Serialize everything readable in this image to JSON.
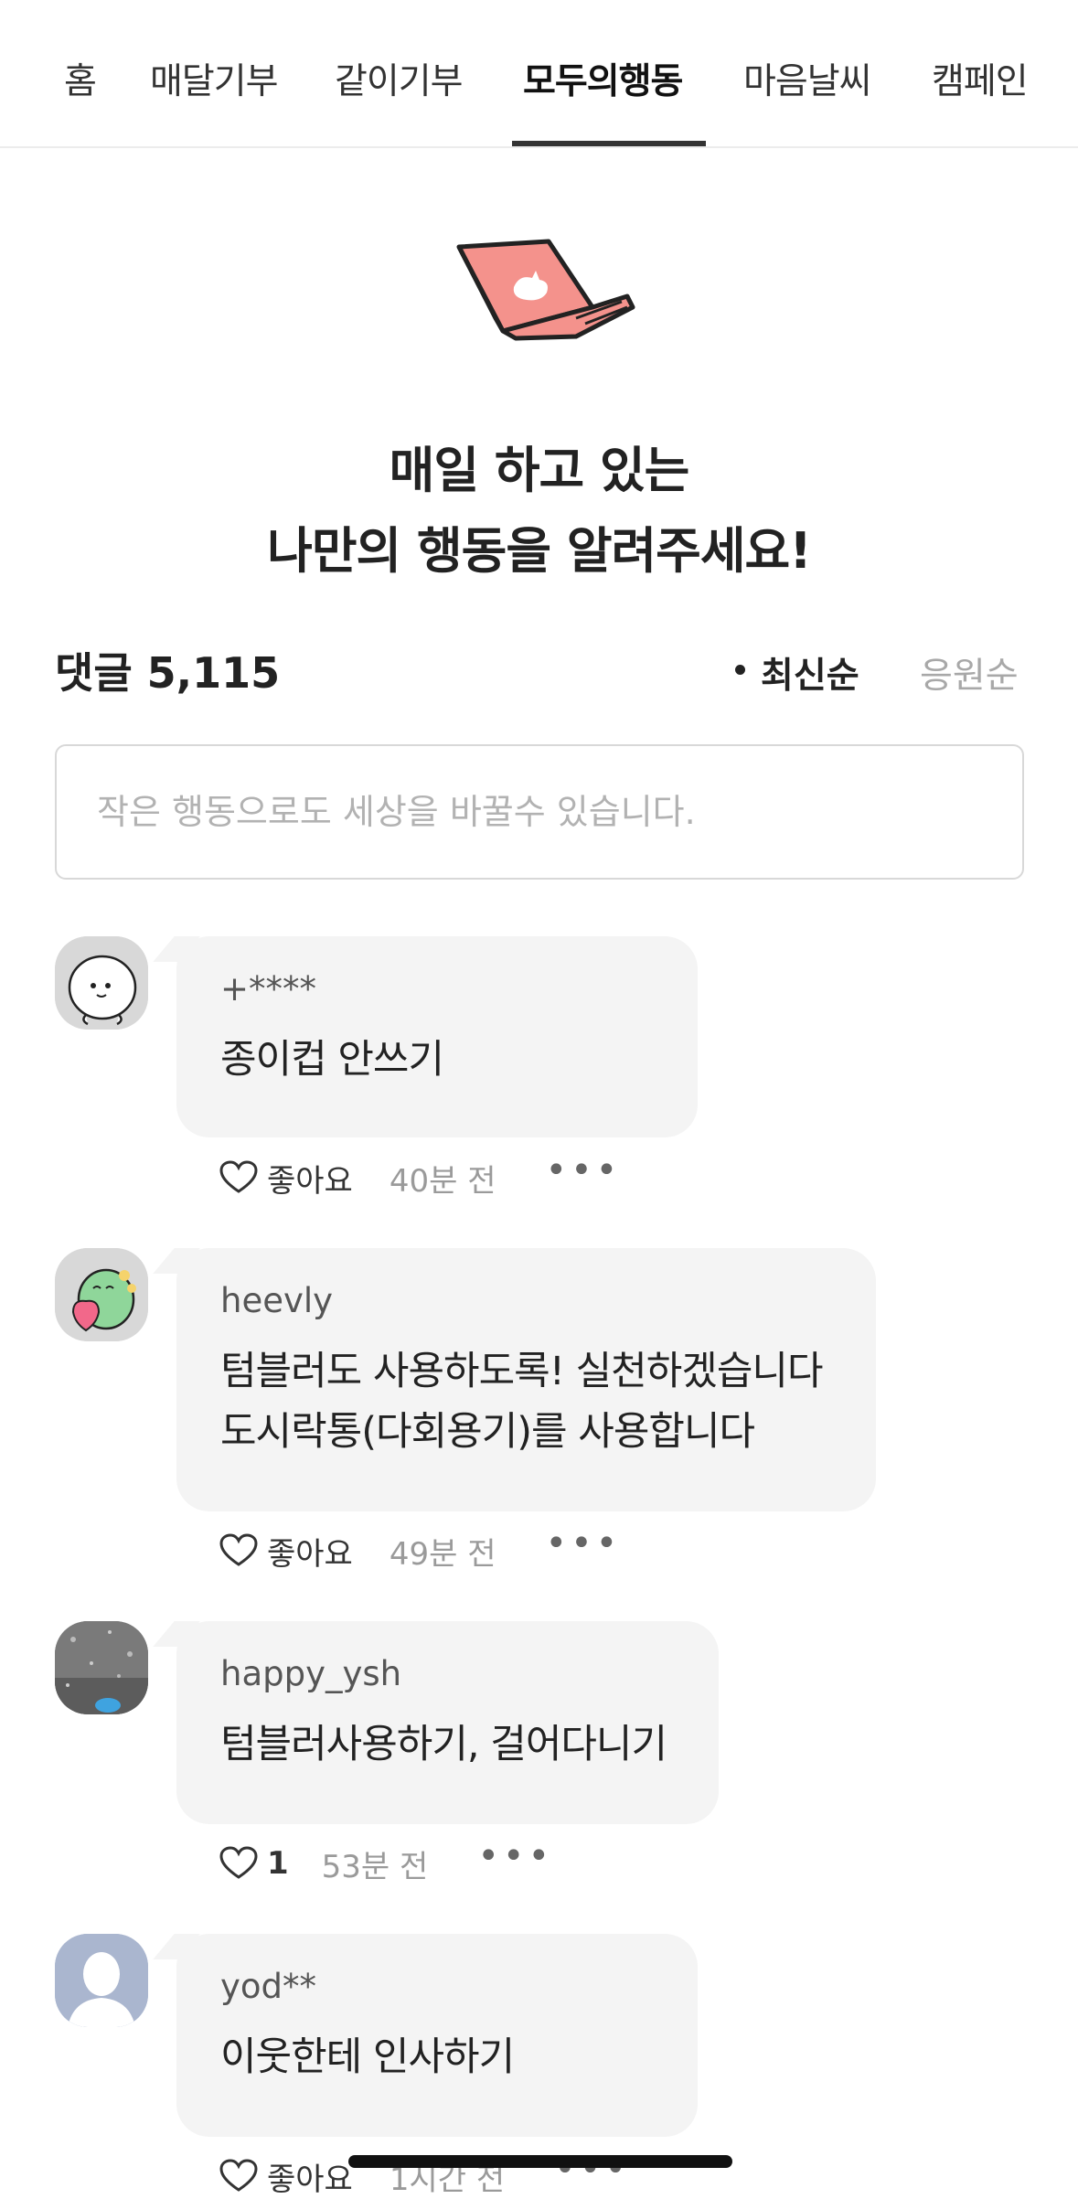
{
  "tabs": [
    {
      "label": "홈"
    },
    {
      "label": "매달기부"
    },
    {
      "label": "같이기부"
    },
    {
      "label": "모두의행동",
      "active": true
    },
    {
      "label": "마음날씨"
    },
    {
      "label": "캠페인"
    }
  ],
  "hero": {
    "icon": "laptop-icon",
    "line1": "매일 하고 있는",
    "line2": "나만의 행동을 알려주세요!"
  },
  "comments_header": {
    "label": "댓글",
    "count": "5,115",
    "sort_latest": "최신순",
    "sort_cheer": "응원순"
  },
  "comment_input": {
    "placeholder": "작은 행동으로도 세상을 바꿀수 있습니다."
  },
  "comments": [
    {
      "author": "+****",
      "body": "종이컵 안쓰기",
      "like_label": "좋아요",
      "time": "40분 전",
      "more": "•••"
    },
    {
      "author": "heevly",
      "body": "텀블러도 사용하도록! 실천하겠습니다\n도시락통(다회용기)를 사용합니다",
      "like_label": "좋아요",
      "time": "49분 전",
      "more": "•••"
    },
    {
      "author": "happy_ysh",
      "body": "텀블러사용하기, 걸어다니기",
      "like_label": "1",
      "time": "53분 전",
      "more": "•••"
    },
    {
      "author": "yod**",
      "body": "이웃한테 인사하기",
      "like_label": "좋아요",
      "time": "1시간 전",
      "more": "•••"
    }
  ],
  "colors": {
    "laptop": "#f4928c",
    "bubble": "#f4f4f4",
    "active_tab": "#333333"
  }
}
